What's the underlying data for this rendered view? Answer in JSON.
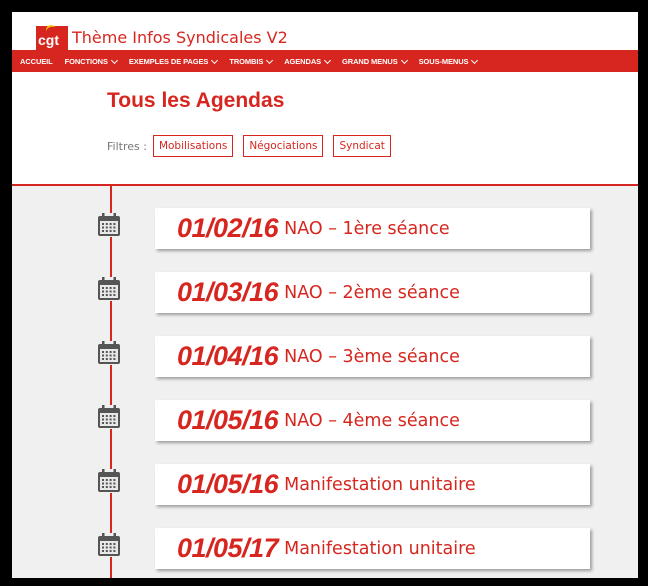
{
  "site": {
    "logo_text": "cgt",
    "title": "Thème Infos Syndicales V2"
  },
  "nav": {
    "items": [
      {
        "label": "ACCUEIL",
        "has_dropdown": false
      },
      {
        "label": "FONCTIONS",
        "has_dropdown": true
      },
      {
        "label": "EXEMPLES DE PAGES",
        "has_dropdown": true
      },
      {
        "label": "TROMBIS",
        "has_dropdown": true
      },
      {
        "label": "AGENDAS",
        "has_dropdown": true
      },
      {
        "label": "GRAND MENUS",
        "has_dropdown": true
      },
      {
        "label": "SOUS-MENUS",
        "has_dropdown": true
      }
    ]
  },
  "page": {
    "title": "Tous les Agendas",
    "filters_label": "Filtres :",
    "filters": [
      "Mobilisations",
      "Négociations",
      "Syndicat"
    ]
  },
  "agenda": {
    "icon": "calendar-icon",
    "accent": "#d7261f",
    "items": [
      {
        "date": "01/02/16",
        "title": "NAO – 1ère séance"
      },
      {
        "date": "01/03/16",
        "title": "NAO – 2ème séance"
      },
      {
        "date": "01/04/16",
        "title": "NAO – 3ème séance"
      },
      {
        "date": "01/05/16",
        "title": "NAO – 4ème séance"
      },
      {
        "date": "01/05/16",
        "title": "Manifestation unitaire"
      },
      {
        "date": "01/05/17",
        "title": "Manifestation unitaire"
      }
    ]
  }
}
